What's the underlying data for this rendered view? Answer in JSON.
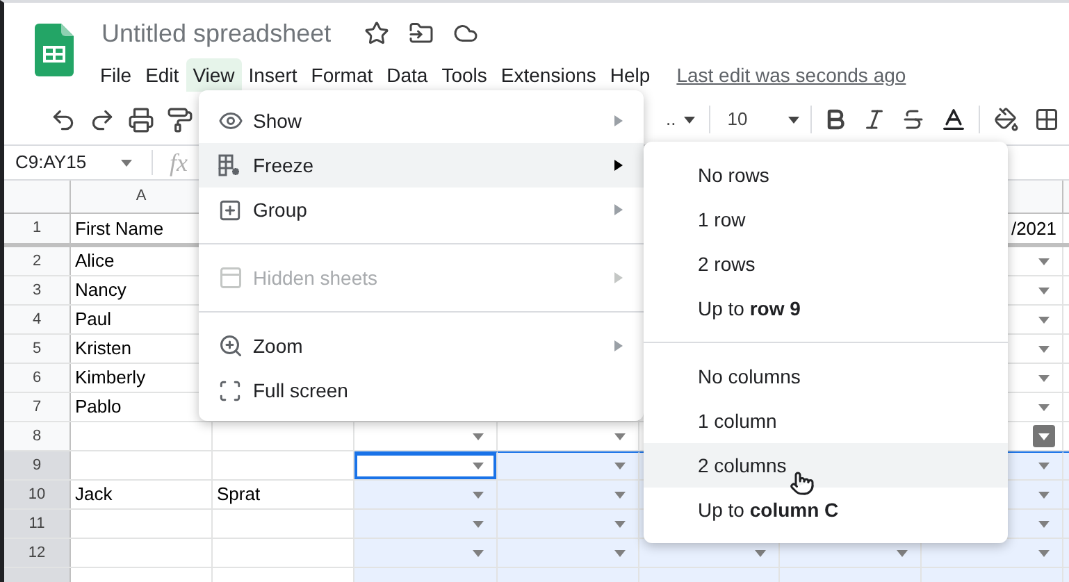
{
  "document": {
    "title": "Untitled spreadsheet",
    "last_edit": "Last edit was seconds ago"
  },
  "menu_bar": [
    {
      "label": "File",
      "selected": false
    },
    {
      "label": "Edit",
      "selected": false
    },
    {
      "label": "View",
      "selected": true
    },
    {
      "label": "Insert",
      "selected": false
    },
    {
      "label": "Format",
      "selected": false
    },
    {
      "label": "Data",
      "selected": false
    },
    {
      "label": "Tools",
      "selected": false
    },
    {
      "label": "Extensions",
      "selected": false
    },
    {
      "label": "Help",
      "selected": false
    }
  ],
  "toolbar": {
    "font": "..",
    "font_size": "10"
  },
  "formula_bar": {
    "name_box": "C9:AY15",
    "fx": "fx"
  },
  "sheet": {
    "column_headers": [
      "A"
    ],
    "rows": [
      {
        "kind": "header",
        "number": "1",
        "column_a": "First Name",
        "column_g": "/2021",
        "selected": false
      },
      {
        "kind": "data",
        "number": "2",
        "column_a": "Alice",
        "selected": false,
        "active": false,
        "dropdown_hovered": false
      },
      {
        "kind": "data",
        "number": "3",
        "column_a": "Nancy",
        "selected": false,
        "active": false,
        "dropdown_hovered": false
      },
      {
        "kind": "data",
        "number": "4",
        "column_a": "Paul",
        "selected": false,
        "active": false,
        "dropdown_hovered": false
      },
      {
        "kind": "data",
        "number": "5",
        "column_a": "Kristen",
        "selected": false,
        "active": false,
        "dropdown_hovered": false
      },
      {
        "kind": "data",
        "number": "6",
        "column_a": "Kimberly",
        "selected": false,
        "active": false,
        "dropdown_hovered": false
      },
      {
        "kind": "data",
        "number": "7",
        "column_a": "Pablo",
        "selected": false,
        "active": false,
        "dropdown_hovered": false
      },
      {
        "kind": "data",
        "number": "8",
        "selected": false,
        "active": false,
        "dropdown_hovered": true
      },
      {
        "kind": "data",
        "number": "9",
        "selected": true,
        "active": true,
        "dropdown_hovered": false
      },
      {
        "kind": "data",
        "number": "10",
        "column_a": "Jack",
        "column_b": "Sprat",
        "selected": true,
        "active": false,
        "dropdown_hovered": false
      },
      {
        "kind": "data",
        "number": "11",
        "selected": true,
        "active": false,
        "dropdown_hovered": false
      },
      {
        "kind": "data",
        "number": "12",
        "selected": true,
        "active": false,
        "dropdown_hovered": false
      }
    ]
  },
  "view_menu": {
    "items": [
      {
        "kind": "item",
        "label": "Show",
        "highlighted": false,
        "disabled": false,
        "submenu": true
      },
      {
        "kind": "item",
        "label": "Freeze",
        "highlighted": true,
        "disabled": false,
        "submenu": true
      },
      {
        "kind": "item",
        "label": "Group",
        "highlighted": false,
        "disabled": false,
        "submenu": true
      },
      {
        "kind": "divider"
      },
      {
        "kind": "item",
        "label": "Hidden sheets",
        "highlighted": false,
        "disabled": true,
        "submenu": true
      },
      {
        "kind": "divider"
      },
      {
        "kind": "item",
        "label": "Zoom",
        "highlighted": false,
        "disabled": false,
        "submenu": true
      },
      {
        "kind": "item",
        "label": "Full screen",
        "highlighted": false,
        "disabled": false,
        "submenu": false
      }
    ]
  },
  "freeze_submenu": {
    "items": [
      {
        "kind": "item",
        "label": "No rows",
        "highlighted": false
      },
      {
        "kind": "item",
        "label": "1 row",
        "highlighted": false
      },
      {
        "kind": "item",
        "label": "2 rows",
        "highlighted": false
      },
      {
        "kind": "item",
        "label": "Up to **row 9**",
        "highlighted": false
      },
      {
        "kind": "divider"
      },
      {
        "kind": "item",
        "label": "No columns",
        "highlighted": false
      },
      {
        "kind": "item",
        "label": "1 column",
        "highlighted": false
      },
      {
        "kind": "item",
        "label": "2 columns",
        "highlighted": true
      },
      {
        "kind": "item",
        "label": "Up to **column C**",
        "highlighted": false
      }
    ]
  }
}
